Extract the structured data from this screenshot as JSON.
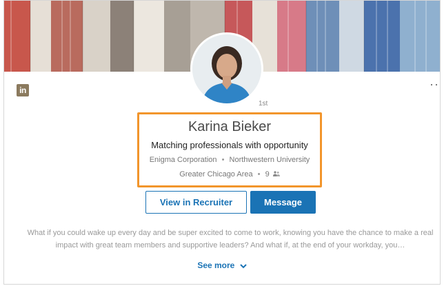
{
  "profile": {
    "name": "Karina Bieker",
    "degree": "1st",
    "headline": "Matching professionals with opportunity",
    "company": "Enigma Corporation",
    "school": "Northwestern University",
    "location": "Greater Chicago Area",
    "connections": "9",
    "separator": "•",
    "summary": "What if you could wake up every day and be super excited to come to work, knowing you have the chance to make a real impact with great team members and supportive leaders? And what if, at the end of your workday, you…"
  },
  "actions": {
    "view_in_recruiter": "View in Recruiter",
    "message": "Message",
    "see_more": "See more"
  },
  "header": {
    "logo_text": "in",
    "more_menu": "···"
  },
  "colors": {
    "accent_blue": "#1a73b5",
    "highlight_orange": "#f2952b",
    "logo_brown": "#8b7a5e"
  },
  "icons": {
    "logo": "linkedin-logo-icon",
    "more": "more-options-icon",
    "connections": "connections-icon",
    "see_more": "chevron-down-icon"
  }
}
